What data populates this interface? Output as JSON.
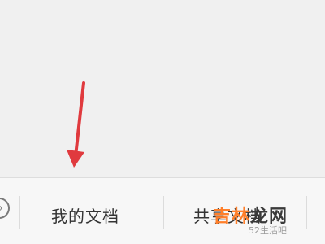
{
  "bottom_nav": {
    "tabs": [
      {
        "label": "我的文档"
      },
      {
        "label": "共享文档"
      }
    ]
  },
  "watermark": {
    "brand_part1": "吉林",
    "brand_part2": "龙网",
    "sub": "52生活吧"
  },
  "colors": {
    "arrow": "#e03a3e",
    "background": "#f0f0f0",
    "watermark_accent": "#ff7f2a"
  }
}
